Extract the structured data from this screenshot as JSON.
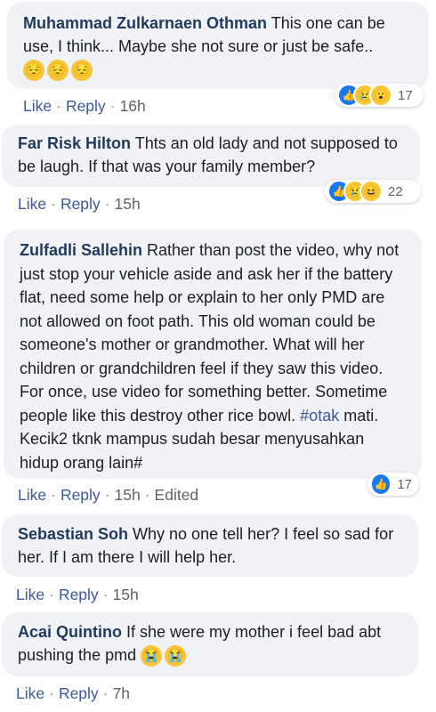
{
  "comments": [
    {
      "author": "Muhammad Zulkarnaen Othman",
      "text": " This one can be use, I think... Maybe she not sure or just be safe..",
      "emojis": [
        "😔",
        "😔",
        "😔"
      ],
      "actions": {
        "like": "Like",
        "reply": "Reply",
        "time": "16h"
      },
      "reactions": {
        "icons": [
          "like-icon",
          "sad-icon",
          "wow-icon"
        ],
        "count": "17"
      }
    },
    {
      "author": "Far Risk Hilton",
      "text": " Thts an old lady and not supposed to be laugh. If that was your family member?",
      "actions": {
        "like": "Like",
        "reply": "Reply",
        "time": "15h"
      },
      "reactions": {
        "icons": [
          "like-icon",
          "sad-icon",
          "haha-icon"
        ],
        "count": "22"
      }
    },
    {
      "author": "Zulfadli Sallehin",
      "text_before": " Rather than post the video, why not just stop your vehicle aside and ask her if the battery flat, need some help or explain to her only PMD are not allowed on foot path. This old woman could be someone's mother or grandmother. What will her children or grandchildren feel if they saw this video. For once, use video for something better. Sometime people like this destroy other rice bowl. ",
      "hashtag": "#otak",
      "text_after": " mati. Kecik2 tknk mampus sudah besar menyusahkan hidup orang lain#",
      "actions": {
        "like": "Like",
        "reply": "Reply",
        "time": "15h",
        "edited": "Edited"
      },
      "reactions": {
        "icons": [
          "like-icon"
        ],
        "count": "17"
      }
    },
    {
      "author": "Sebastian Soh",
      "text": " Why no one tell her? I feel so sad for her. If I am there I will help her.",
      "actions": {
        "like": "Like",
        "reply": "Reply",
        "time": "15h"
      }
    },
    {
      "author": "Acai Quintino",
      "text": " If she were my mother i feel bad abt pushing the pmd ",
      "emojis": [
        "😭",
        "😭"
      ],
      "actions": {
        "like": "Like",
        "reply": "Reply",
        "time": "7h"
      }
    }
  ],
  "colors": {
    "author": "#1e3a5f",
    "link": "#3b5998",
    "bubble": "#f0f2f5",
    "like": "#1877f2"
  }
}
